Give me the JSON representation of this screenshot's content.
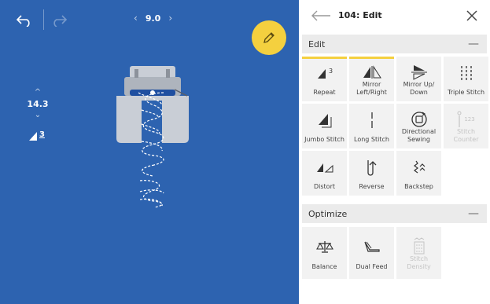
{
  "canvas": {
    "stitch_width": "9.0",
    "stitch_length": "14.3",
    "stitch_type_number": "3",
    "colors": {
      "canvas_bg": "#2d63b0",
      "accent": "#f4d03f"
    }
  },
  "panel": {
    "title": "104: Edit",
    "sections": [
      {
        "title": "Edit",
        "tiles": [
          {
            "label": "Repeat",
            "badge": "3",
            "icon": "repeat-icon",
            "active": true
          },
          {
            "label": "Mirror Left/Right",
            "icon": "mirror-left-right-icon",
            "active": true
          },
          {
            "label": "Mirror Up/ Down",
            "icon": "mirror-up-down-icon",
            "active": false
          },
          {
            "label": "Triple Stitch",
            "icon": "triple-stitch-icon",
            "active": false
          },
          {
            "label": "Jumbo Stitch",
            "icon": "jumbo-stitch-icon",
            "active": false
          },
          {
            "label": "Long Stitch",
            "icon": "long-stitch-icon",
            "active": false
          },
          {
            "label": "Directional Sewing",
            "icon": "directional-sewing-icon",
            "active": false
          },
          {
            "label": "Stitch Counter",
            "badge": "123",
            "icon": "stitch-counter-icon",
            "active": false,
            "disabled": true
          },
          {
            "label": "Distort",
            "icon": "distort-icon",
            "active": false
          },
          {
            "label": "Reverse",
            "icon": "reverse-icon",
            "active": false
          },
          {
            "label": "Backstep",
            "icon": "backstep-icon",
            "active": false
          }
        ]
      },
      {
        "title": "Optimize",
        "tiles": [
          {
            "label": "Balance",
            "icon": "balance-icon"
          },
          {
            "label": "Dual Feed",
            "icon": "dual-feed-icon"
          },
          {
            "label": "Stitch Density",
            "icon": "stitch-density-icon",
            "disabled": true
          }
        ]
      }
    ]
  }
}
